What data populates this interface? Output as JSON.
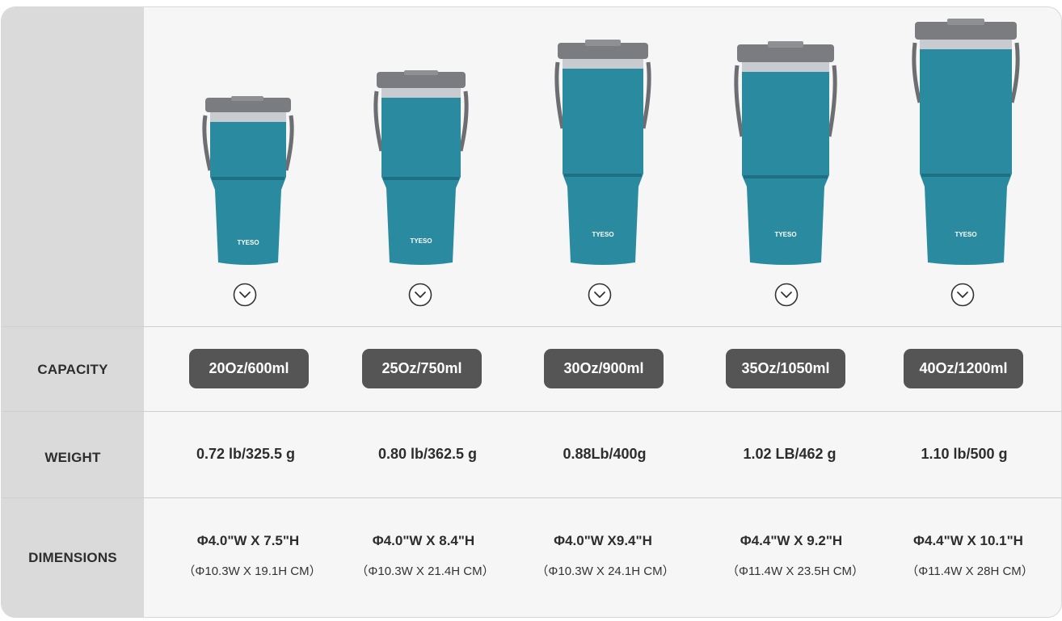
{
  "rows": {
    "capacity": "CAPACITY",
    "weight": "WEIGHT",
    "dimensions": "DIMENSIONS"
  },
  "brand": "TYESO",
  "colors": {
    "tumbler": "#2a8aa0",
    "tumbler_dark": "#1f6f82",
    "lid": "#7a7c80",
    "steel": "#c8ccd0",
    "pill": "#555555",
    "label_column": "#dadada"
  },
  "icons": {
    "expand": "chevron-down-circle-icon"
  },
  "products": [
    {
      "capacity": "20Oz/600ml",
      "weight": "0.72 lb/325.5 g",
      "dim_in": "Φ4.0\"W X 7.5\"H",
      "dim_cm": "（Φ10.3W X 19.1H   CM）"
    },
    {
      "capacity": "25Oz/750ml",
      "weight": "0.80 lb/362.5 g",
      "dim_in": "Φ4.0\"W X 8.4\"H",
      "dim_cm": "（Φ10.3W X 21.4H   CM）"
    },
    {
      "capacity": "30Oz/900ml",
      "weight": "0.88Lb/400g",
      "dim_in": "Φ4.0\"W X9.4\"H",
      "dim_cm": "（Φ10.3W X 24.1H    CM）"
    },
    {
      "capacity": "35Oz/1050ml",
      "weight": "1.02 LB/462 g",
      "dim_in": "Φ4.4\"W X 9.2\"H",
      "dim_cm": "（Φ11.4W X 23.5H   CM）"
    },
    {
      "capacity": "40Oz/1200ml",
      "weight": "1.10 lb/500 g",
      "dim_in": "Φ4.4\"W X 10.1\"H",
      "dim_cm": "（Φ11.4W X 28H   CM）"
    }
  ]
}
